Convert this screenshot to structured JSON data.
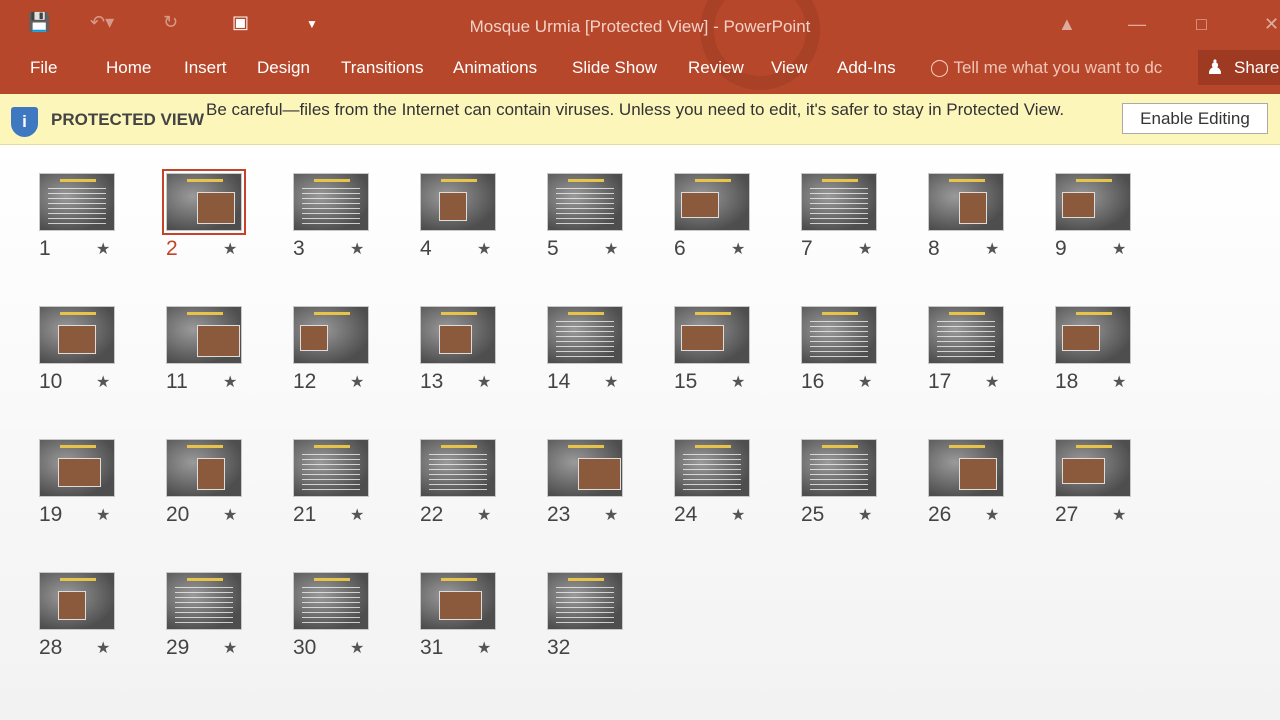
{
  "window": {
    "title": "Mosque Urmia [Protected View] - PowerPoint"
  },
  "ribbon": {
    "tabs": [
      "File",
      "Home",
      "Insert",
      "Design",
      "Transitions",
      "Animations",
      "Slide Show",
      "Review",
      "View",
      "Add-Ins"
    ],
    "tell_me": "Tell me what you want to dc",
    "share": "Share"
  },
  "protected_view": {
    "label": "PROTECTED VIEW",
    "message": "Be careful—files from the Internet can contain viruses. Unless you need to edit, it's safer to stay in Protected View.",
    "enable_button": "Enable Editing"
  },
  "colors": {
    "accent": "#b7472a",
    "selected": "#c4432a",
    "banner": "#fdf6bb"
  },
  "slides": {
    "selected": 2,
    "items": [
      {
        "n": "1",
        "star": true
      },
      {
        "n": "2",
        "star": true
      },
      {
        "n": "3",
        "star": true
      },
      {
        "n": "4",
        "star": true
      },
      {
        "n": "5",
        "star": true
      },
      {
        "n": "6",
        "star": true
      },
      {
        "n": "7",
        "star": true
      },
      {
        "n": "8",
        "star": true
      },
      {
        "n": "9",
        "star": true
      },
      {
        "n": "10",
        "star": true
      },
      {
        "n": "11",
        "star": true
      },
      {
        "n": "12",
        "star": true
      },
      {
        "n": "13",
        "star": true
      },
      {
        "n": "14",
        "star": true
      },
      {
        "n": "15",
        "star": true
      },
      {
        "n": "16",
        "star": true
      },
      {
        "n": "17",
        "star": true
      },
      {
        "n": "18",
        "star": true
      },
      {
        "n": "19",
        "star": true
      },
      {
        "n": "20",
        "star": true
      },
      {
        "n": "21",
        "star": true
      },
      {
        "n": "22",
        "star": true
      },
      {
        "n": "23",
        "star": true
      },
      {
        "n": "24",
        "star": true
      },
      {
        "n": "25",
        "star": true
      },
      {
        "n": "26",
        "star": true
      },
      {
        "n": "27",
        "star": true
      },
      {
        "n": "28",
        "star": true
      },
      {
        "n": "29",
        "star": true
      },
      {
        "n": "30",
        "star": true
      },
      {
        "n": "31",
        "star": true
      },
      {
        "n": "32",
        "star": false
      }
    ]
  }
}
